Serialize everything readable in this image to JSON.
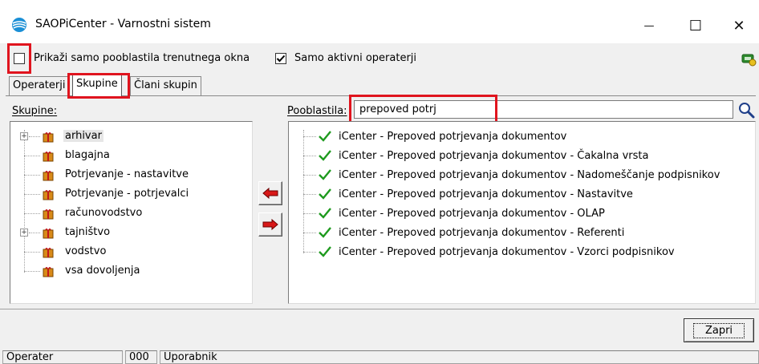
{
  "window": {
    "title": "SAOPiCenter - Varnostni sistem",
    "minimize_glyph": "—",
    "maximize_glyph": "☐",
    "close_glyph": "✕"
  },
  "options": {
    "current_window_only_label": "Prikaži samo pooblastila trenutnega okna",
    "current_window_only_checked": false,
    "active_operators_label": "Samo aktivni operaterji",
    "active_operators_checked": true
  },
  "tabs": [
    {
      "label": "Operaterji",
      "active": false
    },
    {
      "label": "Skupine",
      "active": true
    },
    {
      "label": "Člani skupin",
      "active": false
    }
  ],
  "groups": {
    "label": "Skupine:",
    "items": [
      {
        "label": "arhivar",
        "expandable": true,
        "selected": true
      },
      {
        "label": "blagajna",
        "expandable": false,
        "selected": false
      },
      {
        "label": "Potrjevanje - nastavitve",
        "expandable": false,
        "selected": false
      },
      {
        "label": "Potrjevanje - potrjevalci",
        "expandable": false,
        "selected": false
      },
      {
        "label": "računovodstvo",
        "expandable": false,
        "selected": false
      },
      {
        "label": "tajništvo",
        "expandable": true,
        "selected": false
      },
      {
        "label": "vodstvo",
        "expandable": false,
        "selected": false
      },
      {
        "label": "vsa dovoljenja",
        "expandable": false,
        "selected": false
      }
    ]
  },
  "permissions": {
    "label": "Pooblastila:",
    "search_value": "prepoved potrj",
    "items": [
      "iCenter - Prepoved potrjevanja dokumentov",
      "iCenter - Prepoved potrjevanja dokumentov - Čakalna vrsta",
      "iCenter - Prepoved potrjevanja dokumentov - Nadomeščanje podpisnikov",
      "iCenter - Prepoved potrjevanja dokumentov - Nastavitve",
      "iCenter - Prepoved potrjevanja dokumentov - OLAP",
      "iCenter - Prepoved potrjevanja dokumentov - Referenti",
      "iCenter - Prepoved potrjevanja dokumentov - Vzorci podpisnikov"
    ]
  },
  "buttons": {
    "close_label": "Zapri"
  },
  "status_bar": {
    "role": "Operater",
    "code": "000",
    "user": "Uporabnik"
  },
  "colors": {
    "highlight_red": "#e0141e",
    "check_green": "#1e9a1e",
    "arrow_red": "#d81818"
  }
}
